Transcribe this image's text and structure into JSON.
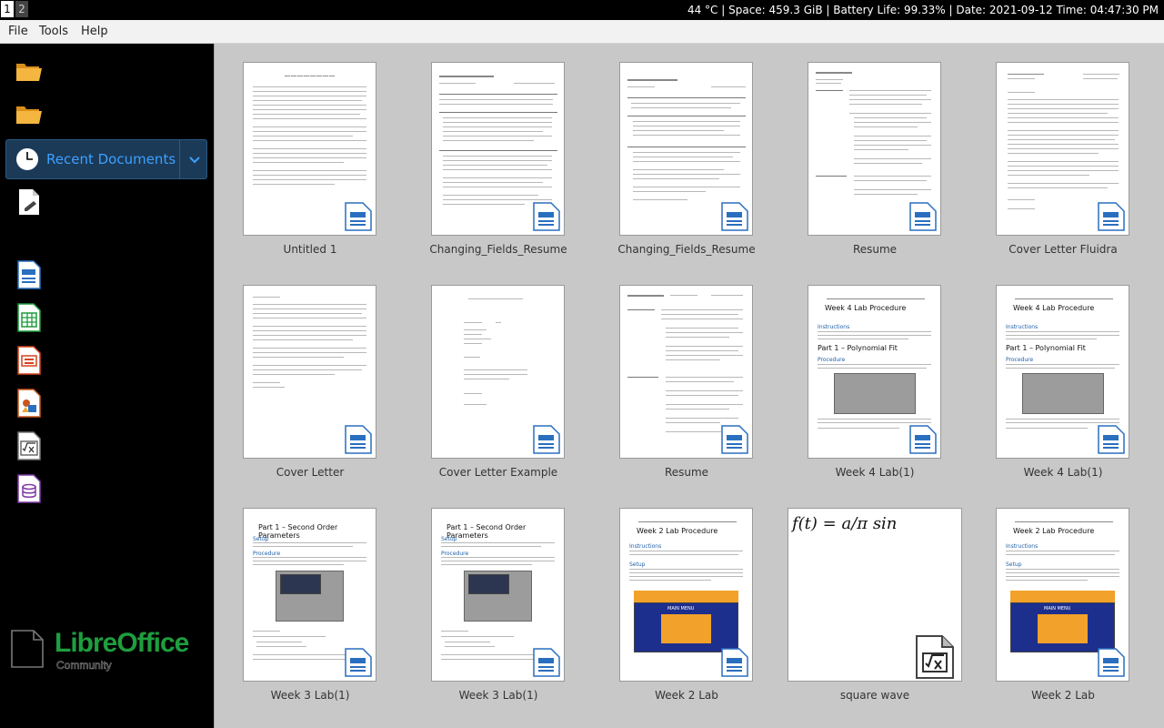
{
  "statusbar": {
    "workspaces": [
      "1",
      "2"
    ],
    "status_text": "44 °C | Space: 459.3 GiB | Battery Life: 99.33% | Date: 2021-09-12  Time: 04:47:30 PM"
  },
  "menubar": {
    "file": "File",
    "tools": "Tools",
    "help": "Help"
  },
  "sidebar": {
    "open_file_icon": "folder-open-icon",
    "remote_files_icon": "folder-remote-icon",
    "recent_label": "Recent Documents",
    "templates_icon": "templates-icon",
    "apps": [
      "writer-icon",
      "calc-icon",
      "impress-icon",
      "draw-icon",
      "math-icon",
      "base-icon"
    ],
    "logo_libre": "LibreOffice",
    "logo_community": "Community"
  },
  "colors": {
    "writer": "#2a6fbf",
    "calc": "#1d9a3c",
    "impress": "#d4421b",
    "draw": "#c9571d",
    "math": "#555555",
    "base": "#7f3aa5",
    "accent": "#3da0ff"
  },
  "documents": [
    {
      "name": "Untitled 1",
      "kind": "writer"
    },
    {
      "name": "Changing_Fields_Resume",
      "kind": "writer"
    },
    {
      "name": "Changing_Fields_Resume",
      "kind": "writer"
    },
    {
      "name": "Resume",
      "kind": "writer"
    },
    {
      "name": "Cover Letter Fluidra",
      "kind": "writer"
    },
    {
      "name": "Cover Letter",
      "kind": "writer"
    },
    {
      "name": "Cover Letter Example",
      "kind": "writer"
    },
    {
      "name": "Resume",
      "kind": "writer"
    },
    {
      "name": "Week 4 Lab(1)",
      "kind": "writer"
    },
    {
      "name": "Week 4 Lab(1)",
      "kind": "writer"
    },
    {
      "name": "Week 3 Lab(1)",
      "kind": "writer"
    },
    {
      "name": "Week 3 Lab(1)",
      "kind": "writer"
    },
    {
      "name": "Week 2 Lab",
      "kind": "writer"
    },
    {
      "name": "square wave",
      "kind": "math"
    },
    {
      "name": "Week 2 Lab",
      "kind": "writer"
    }
  ],
  "thumb_text": {
    "week4_title": "Week 4 Lab Procedure",
    "week4_part": "Part 1 – Polynomial Fit",
    "week3_part": "Part 1 – Second Order Parameters",
    "week2_title": "Week 2 Lab Procedure",
    "week2_menu": "MAIN MENU",
    "math_formula": "f(t) = a/π sin"
  }
}
